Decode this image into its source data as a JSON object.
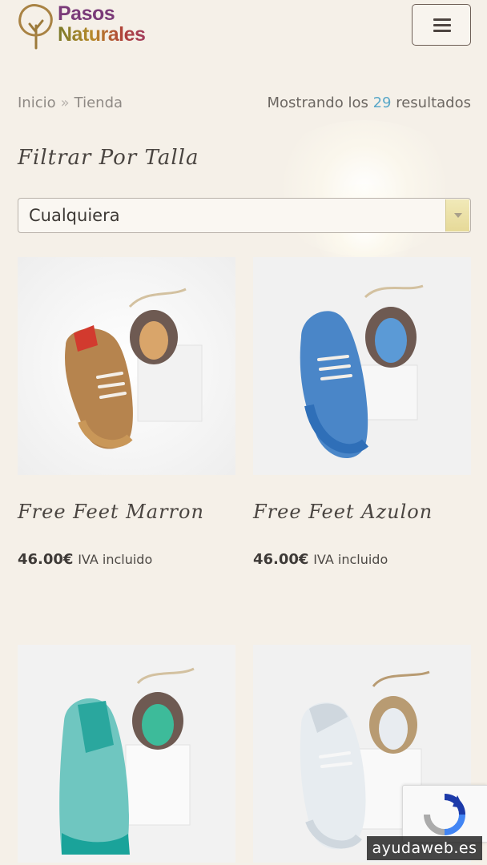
{
  "logo": {
    "line1": "Pasos",
    "line2": "Naturales"
  },
  "header": {
    "menu_icon": "hamburger-icon"
  },
  "breadcrumb": {
    "home": "Inicio",
    "separator": "»",
    "current": "Tienda"
  },
  "results": {
    "prefix": "Mostrando los",
    "count": "29",
    "suffix": "resultados"
  },
  "filter": {
    "title": "Filtrar Por Talla",
    "selected": "Cualquiera"
  },
  "products": [
    {
      "name": "Free Feet Marron",
      "price": "46.00€",
      "tax_label": "IVA incluido",
      "color": "#b6844e",
      "accent": "#d23a2e"
    },
    {
      "name": "Free Feet Azulon",
      "price": "46.00€",
      "tax_label": "IVA incluido",
      "color": "#4a86c8",
      "accent": "#2f6fb8"
    },
    {
      "name": "",
      "price": "",
      "tax_label": "",
      "color": "#6fc6c0",
      "accent": "#1aa39a"
    },
    {
      "name": "",
      "price": "",
      "tax_label": "",
      "color": "#e7ecf0",
      "accent": "#cfd7de"
    }
  ],
  "watermark": "ayudaweb.es",
  "colors": {
    "background": "#f5f0e8",
    "link_accent": "#5aa8c8"
  }
}
